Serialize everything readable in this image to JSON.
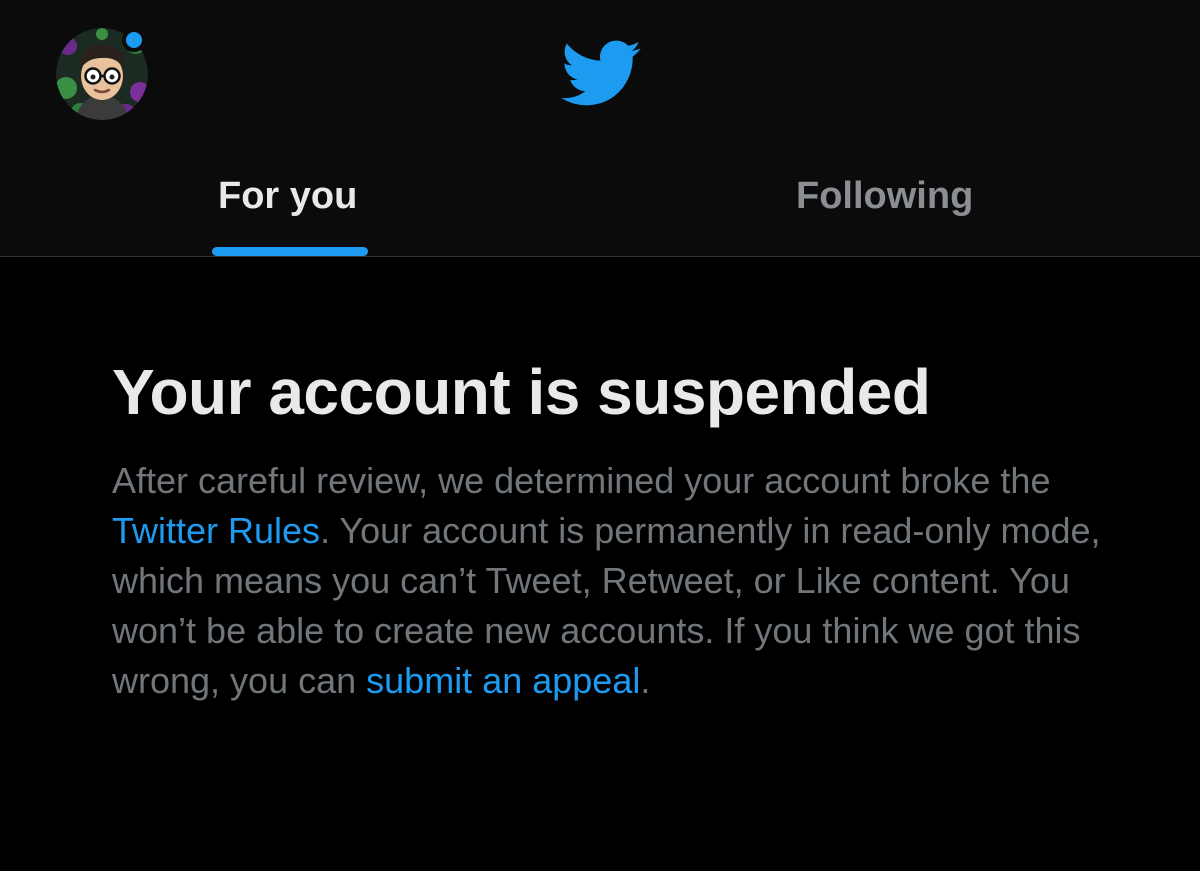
{
  "header": {
    "avatar_icon": "user-avatar",
    "notification_dot_color": "#1d9bf0",
    "logo_icon": "twitter-bird-icon",
    "brand_color": "#1d9bf0"
  },
  "tabs": [
    {
      "label": "For you",
      "active": true
    },
    {
      "label": "Following",
      "active": false
    }
  ],
  "notice": {
    "title": "Your account is suspended",
    "body_part1": "After careful review, we determined your account broke the ",
    "rules_link": "Twitter Rules",
    "body_part2": ". Your account is permanently in read-only mode, which means you can’t Tweet, Retweet, or Like content. You won’t be able to create new accounts. If you think we got this wrong, you can ",
    "appeal_link": "submit an appeal",
    "body_part3": "."
  },
  "colors": {
    "background": "#000000",
    "primary_text": "#e7e9ea",
    "secondary_text": "#71767b",
    "link": "#1d9bf0"
  }
}
